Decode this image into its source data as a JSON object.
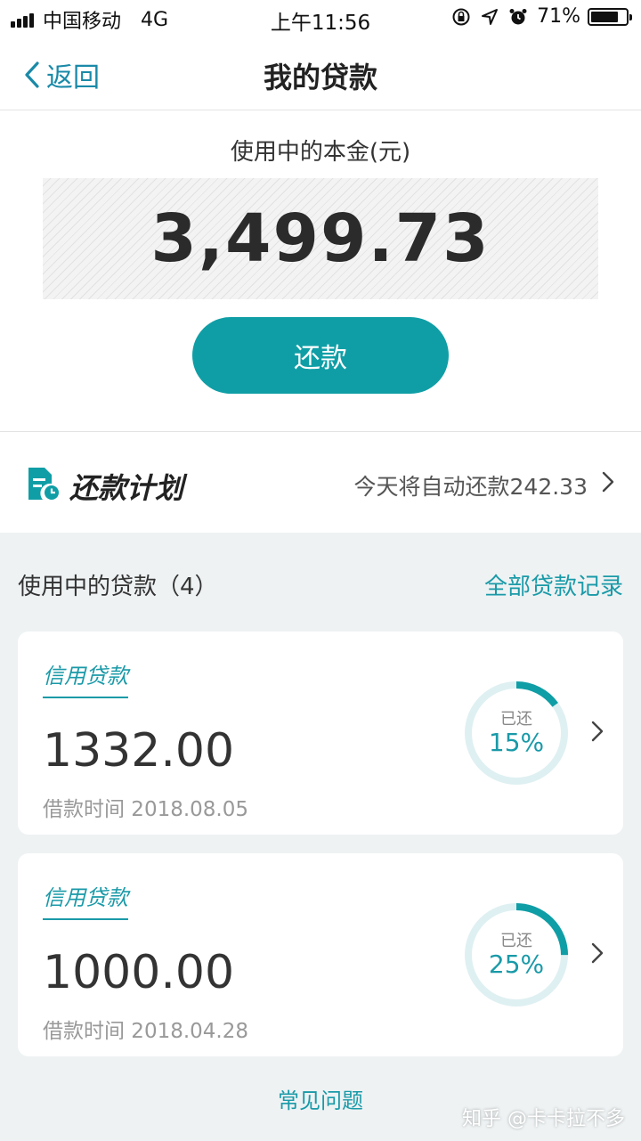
{
  "status_bar": {
    "carrier": "中国移动",
    "network": "4G",
    "time": "上午11:56",
    "battery": "71%"
  },
  "nav": {
    "back_label": "返回",
    "title": "我的贷款"
  },
  "summary": {
    "principal_label": "使用中的本金(元)",
    "principal_amount": "3,499.73",
    "repay_button": "还款"
  },
  "plan": {
    "title": "还款计划",
    "note": "今天将自动还款242.33"
  },
  "loans_section": {
    "title": "使用中的贷款（4）",
    "all_records": "全部贷款记录"
  },
  "loans": [
    {
      "type": "信用贷款",
      "amount": "1332.00",
      "date": "借款时间 2018.08.05",
      "repaid_label": "已还",
      "repaid_pct_text": "15%",
      "repaid_fraction": 0.15
    },
    {
      "type": "信用贷款",
      "amount": "1000.00",
      "date": "借款时间 2018.04.28",
      "repaid_label": "已还",
      "repaid_pct_text": "25%",
      "repaid_fraction": 0.25
    }
  ],
  "footer": {
    "faq": "常见问题",
    "watermark": "知乎 @卡卡拉不多"
  },
  "colors": {
    "accent": "#0f9ea6",
    "accent_text": "#1a9aa8",
    "ring_track": "#dff0f2"
  }
}
